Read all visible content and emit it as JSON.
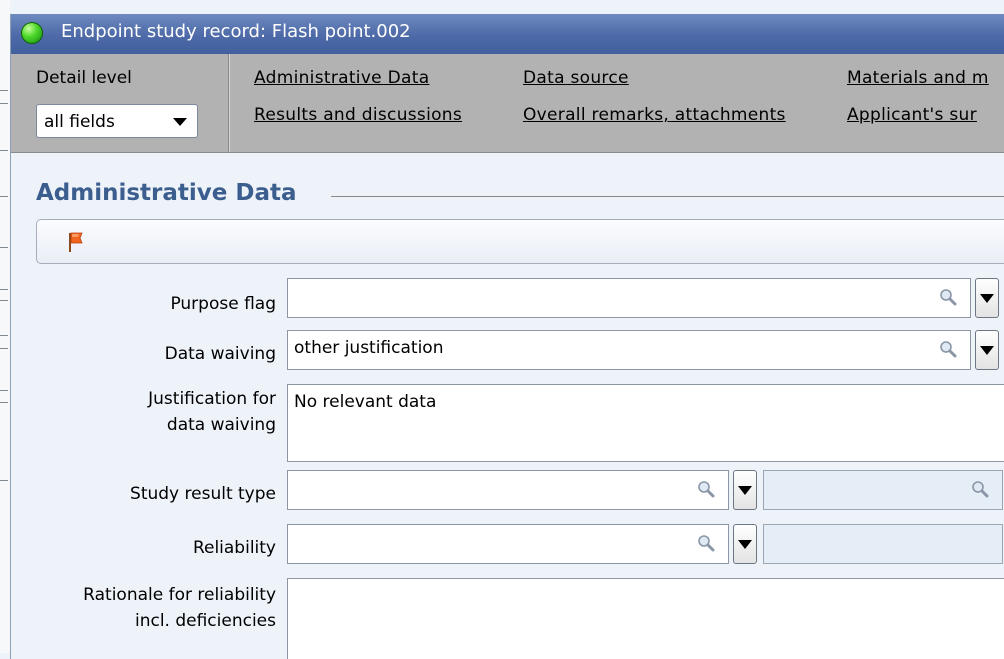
{
  "window": {
    "title": "Endpoint study record: Flash point.002"
  },
  "nav": {
    "detail_level_label": "Detail level",
    "detail_level_value": "all fields",
    "links": [
      "Administrative Data",
      "Data source",
      "Materials and m",
      "Results and discussions",
      "Overall remarks, attachments",
      "Applicant's sur"
    ]
  },
  "section": {
    "title": "Administrative Data",
    "flag_icon": "flag-icon"
  },
  "fields": {
    "purpose_flag": {
      "label": "Purpose flag",
      "value": ""
    },
    "data_waiving": {
      "label": "Data waiving",
      "value": "other justification"
    },
    "justification": {
      "label_line1": "Justification for",
      "label_line2": "data waiving",
      "value": "No relevant data"
    },
    "study_result_type": {
      "label": "Study result type",
      "value": "",
      "secondary_value": ""
    },
    "reliability": {
      "label": "Reliability",
      "value": "",
      "secondary_value": ""
    },
    "rationale": {
      "label_line1": "Rationale for reliability",
      "label_line2": "incl. deficiencies",
      "value": ""
    }
  },
  "colors": {
    "titlebar": "#4d69a7",
    "section_title": "#3b5e8e",
    "status_green": "#4cd62a",
    "flag_orange": "#f0641e"
  }
}
